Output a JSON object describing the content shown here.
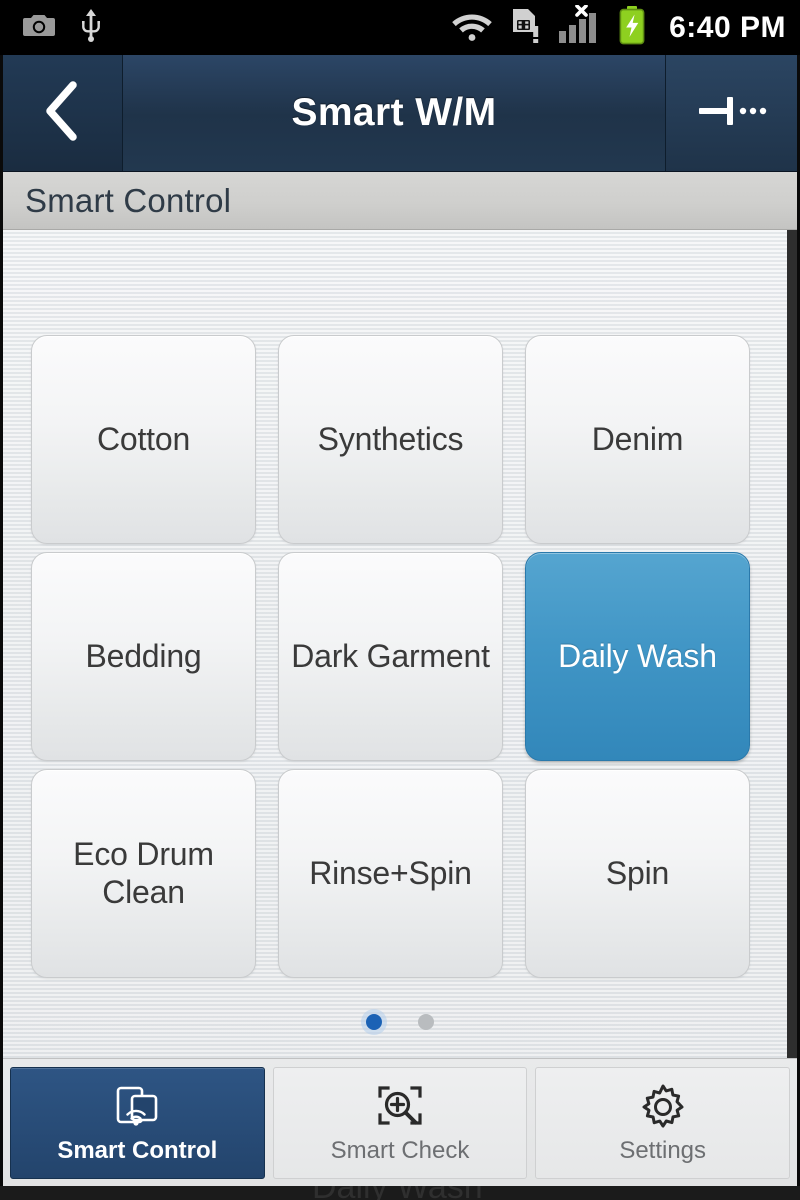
{
  "statusbar": {
    "time": "6:40 PM",
    "icons_left": [
      "camera-icon",
      "usb-icon"
    ],
    "icons_right": [
      "wifi-icon",
      "sim-card-alert-icon",
      "signal-bars-no-service-icon",
      "battery-charging-icon"
    ],
    "battery_color": "#8ed020"
  },
  "titlebar": {
    "back_label": "‹",
    "title": "Smart W/M",
    "menu_icon": "menu-more-icon"
  },
  "subheader": {
    "label": "Smart Control"
  },
  "programs": {
    "tiles": [
      {
        "label": "Cotton",
        "selected": false
      },
      {
        "label": "Synthetics",
        "selected": false
      },
      {
        "label": "Denim",
        "selected": false
      },
      {
        "label": "Bedding",
        "selected": false
      },
      {
        "label": "Dark Garment",
        "selected": false
      },
      {
        "label": "Daily Wash",
        "selected": true
      },
      {
        "label": "Eco Drum Clean",
        "selected": false
      },
      {
        "label": "Rinse+Spin",
        "selected": false
      },
      {
        "label": "Spin",
        "selected": false
      }
    ],
    "selected_label": "Daily Wash",
    "selected_color": "#4196c6"
  },
  "pager": {
    "pages": 2,
    "active_index": 0,
    "active_color": "#1b62b5",
    "inactive_color": "#b9bcbf"
  },
  "tabbar": {
    "active_color": "#23446c",
    "tabs": [
      {
        "label": "Smart Control",
        "icon": "device-wifi-icon",
        "active": true
      },
      {
        "label": "Smart Check",
        "icon": "magnifier-plus-scan-icon",
        "active": false
      },
      {
        "label": "Settings",
        "icon": "gear-icon",
        "active": false
      }
    ]
  },
  "artifact": {
    "ghost_label": "Daily Wash"
  }
}
